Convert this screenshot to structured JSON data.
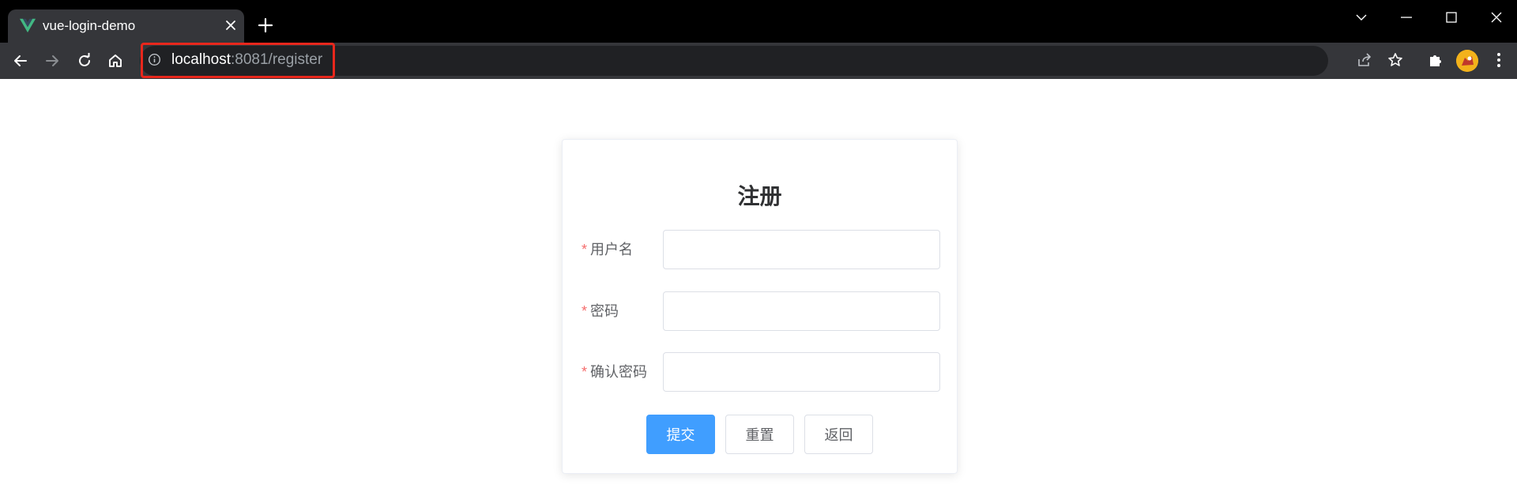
{
  "browser": {
    "tab_title": "vue-login-demo",
    "url_host": "localhost",
    "url_rest": ":8081/register",
    "accent_color": "#42b883",
    "highlight_color": "#e8271c",
    "icons": {
      "tab_logo": "vue-logo-icon",
      "tab_close": "close-icon",
      "new_tab": "plus-icon",
      "back": "arrow-left-icon",
      "forward": "arrow-right-icon",
      "reload": "reload-icon",
      "home": "home-icon",
      "site_info": "info-icon",
      "share": "share-icon",
      "bookmark": "star-icon",
      "extensions": "puzzle-icon",
      "menu": "kebab-menu-icon"
    }
  },
  "form": {
    "title": "注册",
    "fields": [
      {
        "label": "用户名",
        "value": "",
        "required": true
      },
      {
        "label": "密码",
        "value": "",
        "required": true
      },
      {
        "label": "确认密码",
        "value": "",
        "required": true
      }
    ],
    "required_mark": "*",
    "buttons": {
      "submit": "提交",
      "reset": "重置",
      "back": "返回"
    },
    "primary_color": "#409eff",
    "required_color": "#f56c6c"
  }
}
